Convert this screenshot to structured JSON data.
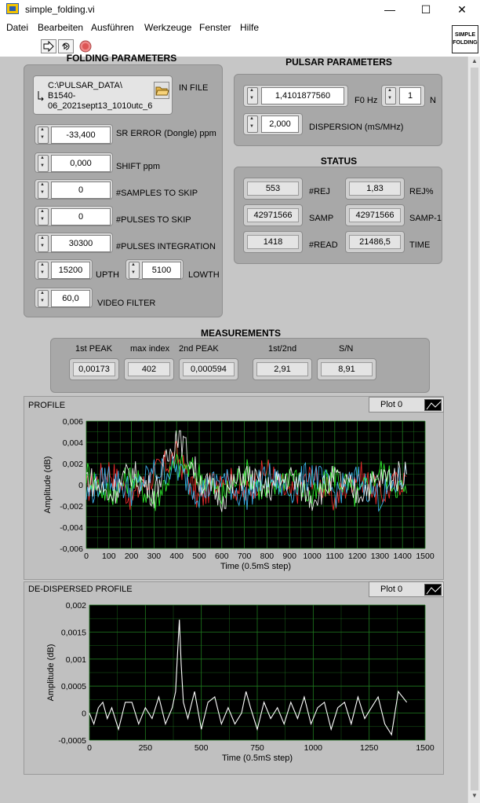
{
  "window": {
    "title": "simple_folding.vi",
    "minimize": "—",
    "maximize": "☐",
    "close": "✕"
  },
  "menu": [
    "Datei",
    "Bearbeiten",
    "Ausführen",
    "Werkzeuge",
    "Fenster",
    "Hilfe"
  ],
  "logo": {
    "line1": "SIMPLE",
    "line2": "FOLDING"
  },
  "folding": {
    "title": "FOLDING PARAMETERS",
    "in_file_label": "IN FILE",
    "in_file_lines": [
      "C:\\PULSAR_DATA\\",
      "B1540-",
      "06_2021sept13_1010utc_6"
    ],
    "sr_error": {
      "label": "SR ERROR (Dongle) ppm",
      "value": "-33,400"
    },
    "shift": {
      "label": "SHIFT ppm",
      "value": "0,000"
    },
    "samples_skip": {
      "label": "#SAMPLES TO SKIP",
      "value": "0"
    },
    "pulses_skip": {
      "label": "#PULSES TO SKIP",
      "value": "0"
    },
    "pulses_integration": {
      "label": "#PULSES INTEGRATION",
      "value": "30300"
    },
    "upth": {
      "label": "UPTH",
      "value": "15200"
    },
    "lowth": {
      "label": "LOWTH",
      "value": "5100"
    },
    "video_filter": {
      "label": "VIDEO FILTER",
      "value": "60,0"
    }
  },
  "pulsar": {
    "title": "PULSAR PARAMETERS",
    "f0": {
      "label": "F0 Hz",
      "value": "1,4101877560"
    },
    "n": {
      "label": "N",
      "value": "1"
    },
    "dispersion": {
      "label": "DISPERSION (mS/MHz)",
      "value": "2,000"
    }
  },
  "status": {
    "title": "STATUS",
    "rej": {
      "label": "#REJ",
      "value": "553"
    },
    "rej_pct": {
      "label": "REJ%",
      "value": "1,83"
    },
    "samp": {
      "label": "SAMP",
      "value": "42971566"
    },
    "samp1": {
      "label": "SAMP-1",
      "value": "42971566"
    },
    "read": {
      "label": "#READ",
      "value": "1418"
    },
    "time": {
      "label": "TIME",
      "value": "21486,5"
    }
  },
  "measurements": {
    "title": "MEASUREMENTS",
    "first_peak": {
      "label": "1st PEAK",
      "value": "0,00173"
    },
    "max_index": {
      "label": "max index",
      "value": "402"
    },
    "second_peak": {
      "label": "2nd PEAK",
      "value": "0,000594"
    },
    "ratio": {
      "label": "1st/2nd",
      "value": "2,91"
    },
    "sn": {
      "label": "S/N",
      "value": "8,91"
    }
  },
  "colors": {
    "panel": "#c6c6c6",
    "group": "#a8a8a8",
    "plot_bg": "#000000",
    "grid": "#1f7a1f",
    "trace": "#ffffff"
  },
  "chart_data": [
    {
      "type": "line",
      "title": "PROFILE",
      "legend": "Plot 0",
      "xlabel": "Time (0.5mS step)",
      "ylabel": "Amplitude (dB)",
      "xlim": [
        0,
        1500
      ],
      "ylim": [
        -0.006,
        0.006
      ],
      "x_ticks": [
        "0",
        "100",
        "200",
        "300",
        "400",
        "500",
        "600",
        "700",
        "800",
        "900",
        "1000",
        "1100",
        "1200",
        "1300",
        "1400",
        "1500"
      ],
      "y_ticks": [
        "0,006",
        "0,004",
        "0,002",
        "0",
        "-0,002",
        "-0,004",
        "-0,006"
      ],
      "grid": true,
      "series": [
        {
          "color": "#ffffff",
          "x": [
            0,
            100,
            200,
            300,
            390,
            400,
            500,
            600,
            700,
            800,
            900,
            1000,
            1100,
            1200,
            1300,
            1418
          ],
          "values": [
            0.0008,
            -0.001,
            0.0012,
            -0.0008,
            0.004,
            0.0052,
            0.0005,
            -0.0012,
            0.001,
            -0.0005,
            0.0008,
            -0.0012,
            0.0006,
            -0.0008,
            0.0005,
            0.001
          ]
        },
        {
          "color": "#ff3030",
          "x": [
            0,
            100,
            200,
            300,
            400,
            500,
            600,
            700,
            800,
            900,
            1000,
            1100,
            1200,
            1300,
            1418
          ],
          "values": [
            -0.0005,
            0.0015,
            -0.0012,
            0.001,
            0.0028,
            -0.0015,
            0.0012,
            -0.001,
            0.0015,
            -0.0012,
            0.001,
            -0.0015,
            0.0012,
            -0.001,
            0.0008
          ]
        },
        {
          "color": "#30ff30",
          "x": [
            0,
            100,
            200,
            300,
            400,
            500,
            600,
            700,
            800,
            900,
            1000,
            1100,
            1200,
            1300,
            1418
          ],
          "values": [
            0.0012,
            -0.001,
            0.0008,
            -0.0015,
            0.002,
            0.001,
            -0.0012,
            0.0014,
            -0.001,
            0.0012,
            -0.0014,
            0.001,
            -0.0012,
            0.0014,
            -0.0008
          ]
        },
        {
          "color": "#40c0ff",
          "x": [
            0,
            100,
            200,
            300,
            400,
            500,
            600,
            700,
            800,
            900,
            1000,
            1100,
            1200,
            1300,
            1418
          ],
          "values": [
            -0.001,
            0.0008,
            -0.0006,
            0.0012,
            0.0015,
            -0.0008,
            0.0006,
            -0.0012,
            0.0008,
            -0.0006,
            0.0012,
            -0.0008,
            0.0006,
            -0.0012,
            0.001
          ]
        }
      ]
    },
    {
      "type": "line",
      "title": "DE-DISPERSED PROFILE",
      "legend": "Plot 0",
      "xlabel": "Time (0.5mS step)",
      "ylabel": "Amplitude (dB)",
      "xlim": [
        0,
        1500
      ],
      "ylim": [
        -0.0005,
        0.002
      ],
      "x_ticks": [
        "0",
        "250",
        "500",
        "750",
        "1000",
        "1250",
        "1500"
      ],
      "y_ticks": [
        "0,002",
        "0,0015",
        "0,001",
        "0,0005",
        "0",
        "-0,0005"
      ],
      "grid": true,
      "series": [
        {
          "color": "#ffffff",
          "x": [
            0,
            20,
            40,
            60,
            80,
            100,
            130,
            160,
            190,
            220,
            250,
            280,
            310,
            340,
            370,
            385,
            395,
            402,
            410,
            420,
            440,
            470,
            500,
            530,
            560,
            590,
            620,
            650,
            680,
            700,
            720,
            750,
            780,
            810,
            840,
            870,
            900,
            930,
            960,
            990,
            1020,
            1050,
            1080,
            1110,
            1140,
            1170,
            1200,
            1230,
            1260,
            1290,
            1320,
            1350,
            1380,
            1418
          ],
          "values": [
            0,
            -0.0002,
            0.0001,
            0.0002,
            -0.0001,
            0.0001,
            -0.0003,
            0.0002,
            0.0002,
            -0.0002,
            0.0001,
            -0.0001,
            0.0003,
            -0.0002,
            0.0001,
            0.0004,
            0.0012,
            0.00173,
            0.0009,
            0.0002,
            -0.0001,
            0.0004,
            -0.0003,
            0.0002,
            0.0003,
            -0.0002,
            0.0001,
            -0.0002,
            0.0,
            0.0004,
            0.0001,
            -0.0003,
            0.0002,
            -0.0001,
            0.0001,
            -0.0002,
            0.0002,
            -0.0001,
            0.0003,
            -0.0002,
            0.0001,
            0.0002,
            -0.0003,
            0.0001,
            0.0002,
            -0.0002,
            0.0003,
            -0.0001,
            0.0001,
            0.0003,
            -0.0002,
            -0.0004,
            0.0004,
            0.0002
          ]
        }
      ]
    }
  ]
}
